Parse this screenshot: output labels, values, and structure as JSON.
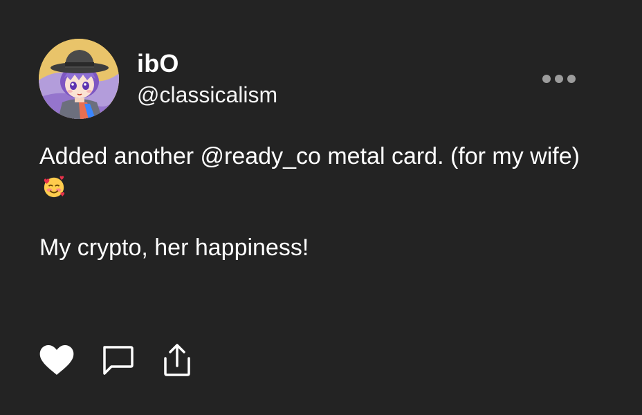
{
  "user": {
    "display_name": "ibO",
    "handle": "@classicalism",
    "avatar_icon": "anime-avatar-icon"
  },
  "post": {
    "line1": "Added another @ready_co metal card. (for my wife)",
    "emoji": "smiling-face-with-hearts",
    "line2": "My crypto, her happiness!"
  },
  "actions": {
    "like_icon": "heart-icon",
    "comment_icon": "comment-icon",
    "share_icon": "share-icon",
    "more_icon": "more-dots-icon"
  },
  "colors": {
    "background": "#232323",
    "text": "#ffffff",
    "muted": "#9c9c9c"
  }
}
